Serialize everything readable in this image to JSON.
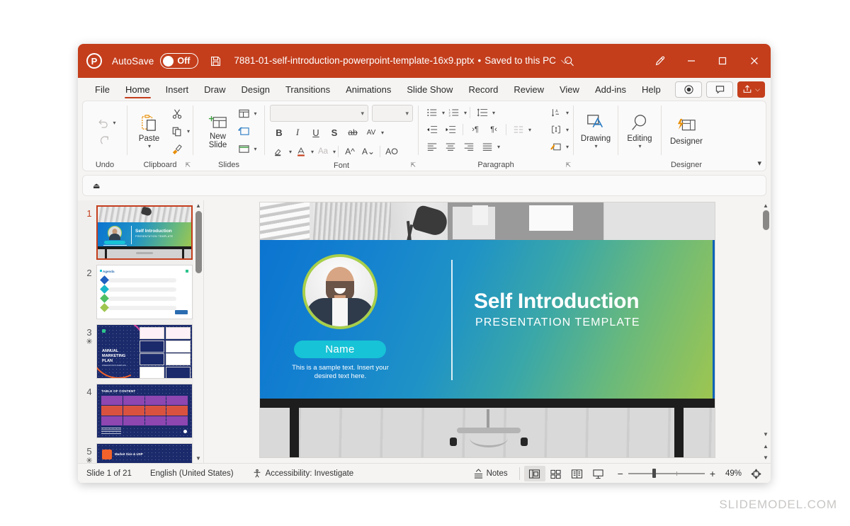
{
  "titlebar": {
    "app_icon": "powerpoint-logo-icon",
    "autosave_label": "AutoSave",
    "autosave_state": "Off",
    "save_icon": "save-disk-icon",
    "document_name": "7881-01-self-introduction-powerpoint-template-16x9.pptx",
    "separator": "•",
    "save_status": "Saved to this PC",
    "dropdown_chevron": "⌵",
    "search_icon": "search-icon",
    "pen_icon": "pen-annotate-icon",
    "minimize": "─",
    "maximize": "☐",
    "close": "✕",
    "bg_color": "#c43e1c"
  },
  "ribbon_tabs": {
    "items": [
      {
        "label": "File",
        "active": false
      },
      {
        "label": "Home",
        "active": true
      },
      {
        "label": "Insert",
        "active": false
      },
      {
        "label": "Draw",
        "active": false
      },
      {
        "label": "Design",
        "active": false
      },
      {
        "label": "Transitions",
        "active": false
      },
      {
        "label": "Animations",
        "active": false
      },
      {
        "label": "Slide Show",
        "active": false
      },
      {
        "label": "Record",
        "active": false
      },
      {
        "label": "Review",
        "active": false
      },
      {
        "label": "View",
        "active": false
      },
      {
        "label": "Add-ins",
        "active": false
      },
      {
        "label": "Help",
        "active": false
      }
    ],
    "record_button": "record-circle-icon",
    "comments_button": "comments-icon",
    "share_button": "share-icon",
    "share_chevron": "⌵",
    "accent_color": "#c43e1c"
  },
  "ribbon": {
    "groups": [
      {
        "name": "Undo",
        "label": "Undo"
      },
      {
        "name": "Clipboard",
        "label": "Clipboard",
        "paste_label": "Paste"
      },
      {
        "name": "Slides",
        "label": "Slides",
        "new_slide_label": "New\nSlide"
      },
      {
        "name": "Font",
        "label": "Font",
        "font_name_value": "",
        "font_size_value": ""
      },
      {
        "name": "Paragraph",
        "label": "Paragraph"
      },
      {
        "name": "Drawing",
        "label": "",
        "drawing_label": "Drawing"
      },
      {
        "name": "Editing",
        "label": "",
        "editing_label": "Editing"
      },
      {
        "name": "Designer",
        "label": "Designer",
        "designer_label": "Designer"
      }
    ],
    "expand_chevron": "⌵",
    "font_buttons": [
      "B",
      "I",
      "U",
      "S",
      "ab",
      "AV"
    ],
    "collapse_arrow_icon": "ribbon-collapse-icon"
  },
  "thumbnails": [
    {
      "number": "1",
      "selected": true,
      "animated": false
    },
    {
      "number": "2",
      "selected": false,
      "animated": false
    },
    {
      "number": "3",
      "selected": false,
      "animated": true,
      "star": "✳"
    },
    {
      "number": "4",
      "selected": false,
      "animated": false
    },
    {
      "number": "5",
      "selected": false,
      "animated": true,
      "star": "✳"
    }
  ],
  "slide": {
    "title": "Self Introduction",
    "subtitle": "PRESENTATION TEMPLATE",
    "name_pill": "Name",
    "sample_text": "This is a sample text. Insert your desired text here.",
    "gradient_start": "#0b74d0",
    "gradient_end": "#9fc64f",
    "pill_color": "#17c3d6",
    "avatar_ring_color": "#a8cf4a"
  },
  "statusbar": {
    "slide_count": "Slide 1 of 21",
    "language": "English (United States)",
    "accessibility_icon": "accessibility-icon",
    "accessibility": "Accessibility: Investigate",
    "notes_label": "Notes",
    "notes_icon": "notes-icon",
    "view_normal": "normal-view-icon",
    "view_sorter": "slide-sorter-icon",
    "view_reading": "reading-view-icon",
    "view_slideshow": "slideshow-icon",
    "zoom_out": "−",
    "zoom_in": "+",
    "zoom_level": "49%",
    "fit_icon": "fit-to-window-icon"
  },
  "watermark": {
    "text": "SLIDEMODEL.COM"
  }
}
